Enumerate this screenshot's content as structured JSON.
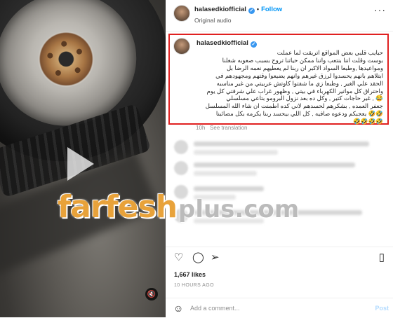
{
  "post": {
    "username": "halasedkiofficial",
    "separator": "•",
    "follow_label": "Follow",
    "audio_label": "Original audio",
    "more_label": "···"
  },
  "caption": {
    "username": "halasedkiofficial",
    "lines": [
      "حبايب قلبي بعض المواقع اتريقت لما عملت",
      "بوست وقلت اننا بنتعب واننا ممكن حياتنا تروح بسبب صعوبه شغلنا",
      "ومواعيدها ,وطبعا السواد الاكبر ان ربنا لم يعطيهم نعمه الرضا بل",
      "ابتلاهم بانهم يحسدوا لرزق غيرهم وانهم يضيعوا وقتهم ومجهودهم في",
      "الحقد علي الغير , وطبعا زي ما شفتوا كاوتش عربيتي من غير مناسبه",
      "واحتراق كل مواتير الكهرباء في بيتي , وظهور غراب علي شرفتي كل يوم",
      "😂 , غير حاجات كتير , وكل ده بعد نزول البرومو بتاعي مسلسلي",
      "جعفر العمده , بشكرهم لحسدهم لاني كده اطمنت ان شاء الله المسلسل",
      "🤣🤣 يعجبكم ودعوه صافيه , كل اللي بيحسد ربنا يكرمه بكل مصائبنا",
      "🤣🤣🤣🤣"
    ],
    "age": "10h",
    "see_translation": "See translation"
  },
  "actions": {
    "like_icon": "heart-icon",
    "comment_icon": "comment-icon",
    "share_icon": "share-icon",
    "save_icon": "bookmark-icon"
  },
  "likes": "1,667 likes",
  "timestamp": "10 HOURS AGO",
  "comment_box": {
    "placeholder": "Add a comment...",
    "post_label": "Post"
  },
  "watermark": {
    "brand": "farfesh",
    "suffix": "plus.com"
  },
  "colors": {
    "follow": "#0095f6",
    "highlight_border": "#e02020",
    "watermark_orange": "#e8a23a"
  }
}
